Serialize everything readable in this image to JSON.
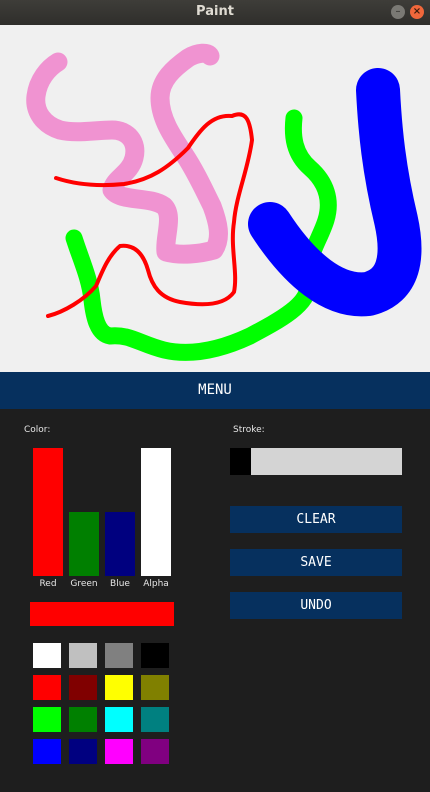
{
  "window": {
    "title": "Paint",
    "minimize_glyph": "–",
    "close_glyph": "×"
  },
  "menu": {
    "label": "MENU"
  },
  "color_panel": {
    "label": "Color:",
    "channels": [
      {
        "name": "Red",
        "color": "#ff0000",
        "level": 1.0
      },
      {
        "name": "Green",
        "color": "#007f00",
        "level": 0.5
      },
      {
        "name": "Blue",
        "color": "#00007f",
        "level": 0.5
      },
      {
        "name": "Alpha",
        "color": "#ffffff",
        "level": 1.0
      }
    ],
    "current_color": "#ff0000",
    "palette": [
      "#ffffff",
      "#c0c0c0",
      "#808080",
      "#000000",
      "#ff0000",
      "#800000",
      "#ffff00",
      "#808000",
      "#00ff00",
      "#008000",
      "#00ffff",
      "#008080",
      "#0000ff",
      "#000080",
      "#ff00ff",
      "#800080"
    ]
  },
  "stroke_panel": {
    "label": "Stroke:",
    "level": 0.12
  },
  "actions": {
    "clear": "CLEAR",
    "save": "SAVE",
    "undo": "UNDO"
  },
  "colors": {
    "menu_bar": "#06305e",
    "panel_bg": "#1e1e1e",
    "canvas_bg": "#f0f0f0"
  }
}
